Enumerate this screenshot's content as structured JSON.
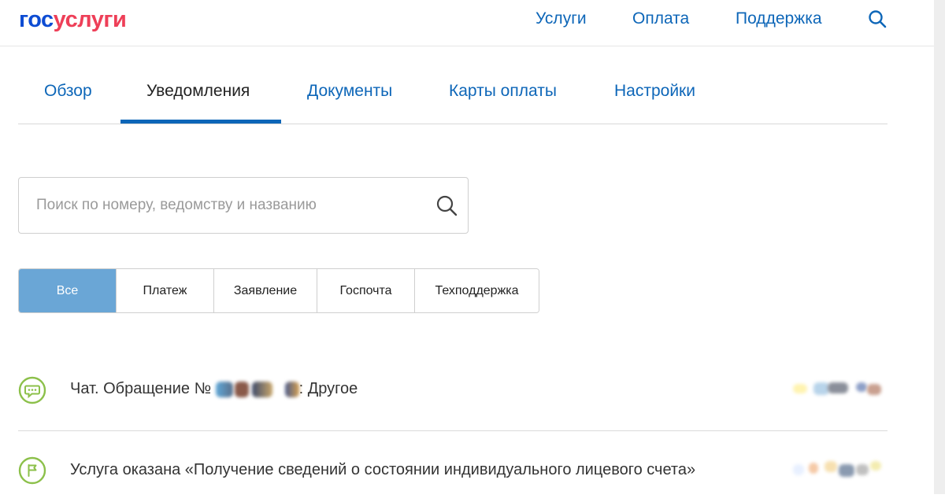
{
  "header": {
    "logo_part1": "гос",
    "logo_part2": "услуги",
    "nav": [
      "Услуги",
      "Оплата",
      "Поддержка"
    ],
    "search_icon": "search-icon"
  },
  "tabs": [
    {
      "label": "Обзор",
      "active": false
    },
    {
      "label": "Уведомления",
      "active": true
    },
    {
      "label": "Документы",
      "active": false
    },
    {
      "label": "Карты оплаты",
      "active": false
    },
    {
      "label": "Настройки",
      "active": false
    }
  ],
  "search": {
    "placeholder": "Поиск по номеру, ведомству и названию",
    "value": ""
  },
  "filters": [
    {
      "label": "Все",
      "active": true
    },
    {
      "label": "Платеж",
      "active": false
    },
    {
      "label": "Заявление",
      "active": false
    },
    {
      "label": "Госпочта",
      "active": false
    },
    {
      "label": "Техподдержка",
      "active": false
    }
  ],
  "notifications": [
    {
      "icon": "chat-icon",
      "title_prefix": "Чат. Обращение № ",
      "title_suffix": ": Другое"
    },
    {
      "icon": "flag-icon",
      "title": "Услуга оказана «Получение сведений о состоянии индивидуального лицевого счета»"
    }
  ],
  "colors": {
    "link": "#0d66b8",
    "logo_blue": "#0d4cd3",
    "logo_red": "#ee3f58",
    "filter_active": "#6aa6d6",
    "icon_green": "#8cc04a"
  }
}
